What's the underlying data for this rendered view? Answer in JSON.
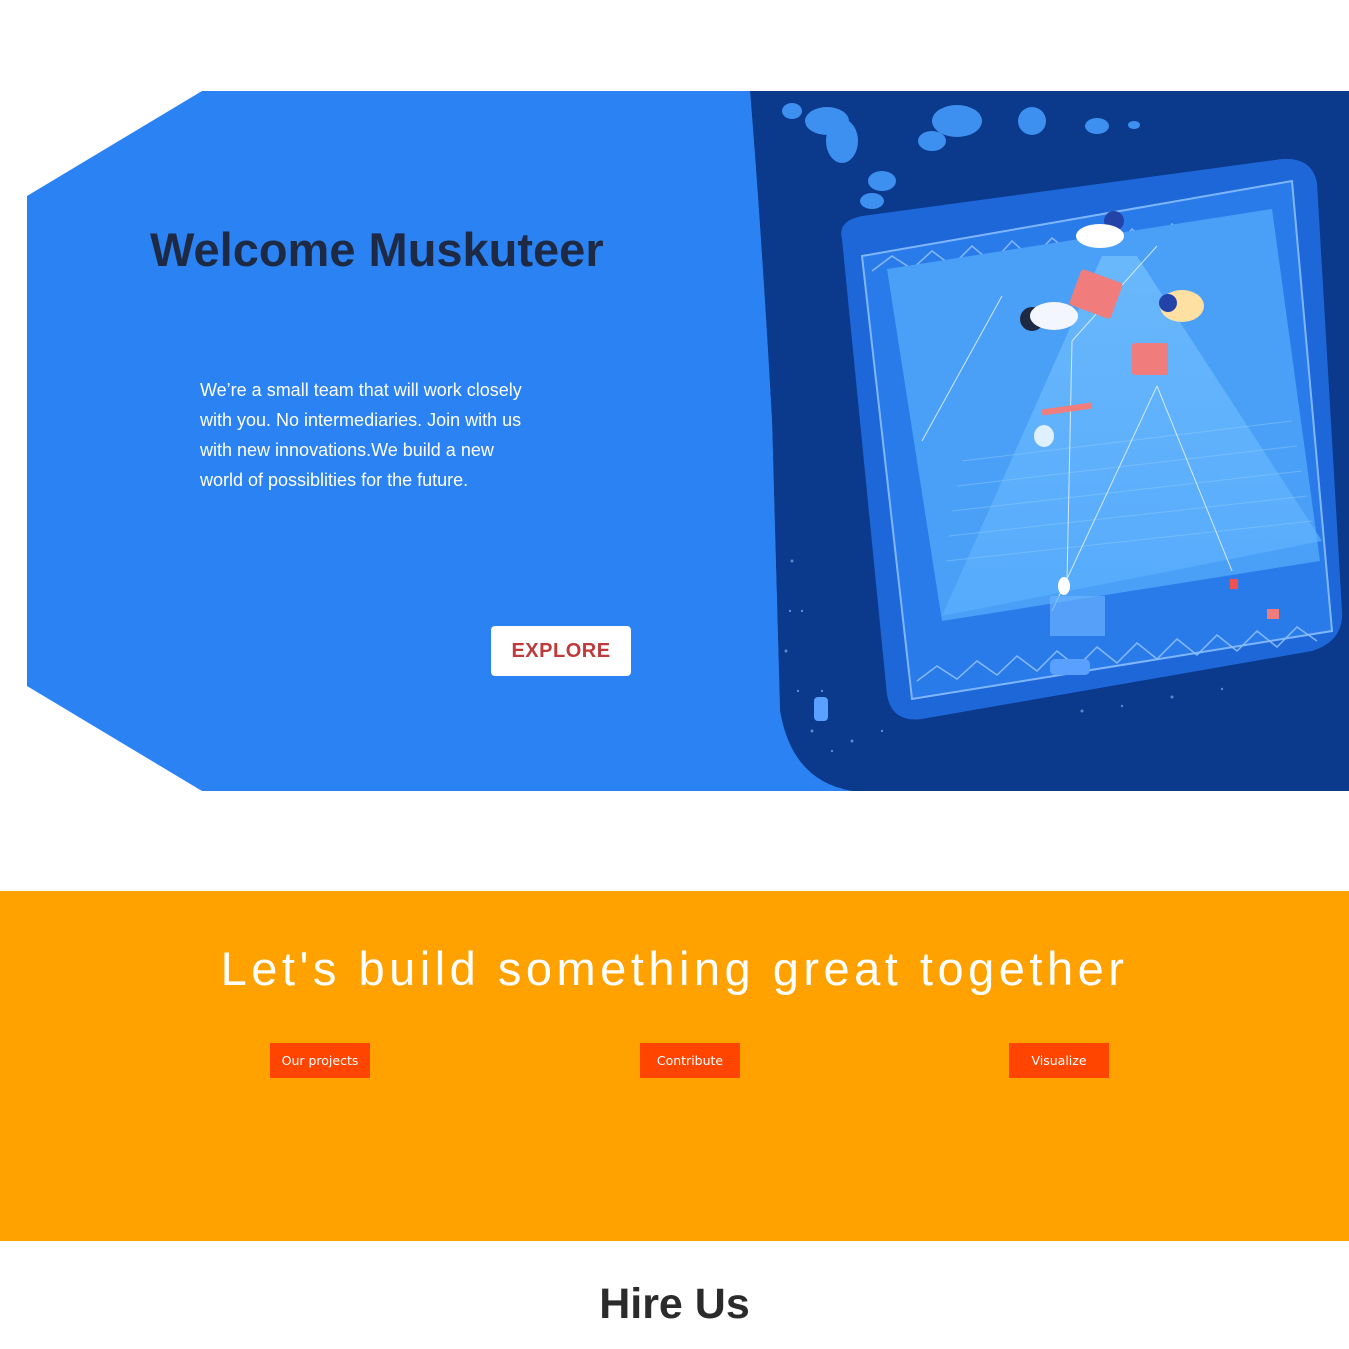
{
  "hero": {
    "title": "Welcome Muskuteer",
    "description": "We’re a small team that will work closely with you. No intermediaries. Join with us with new innovations.We build a new world of possiblities for the future.",
    "explore_label": "EXPLORE",
    "illustration_icon": "workspace-illustration"
  },
  "cta": {
    "heading": "Let's build something great together",
    "buttons": {
      "projects_label": "Our projects",
      "contribute_label": "Contribute",
      "visualize_label": "Visualize"
    }
  },
  "hire": {
    "title": "Hire Us"
  },
  "colors": {
    "hero_blue": "#2a82f3",
    "hero_title": "#1e2a44",
    "explore_text": "#c0393b",
    "cta_orange": "#ffa200",
    "cta_button": "#ff4500"
  }
}
